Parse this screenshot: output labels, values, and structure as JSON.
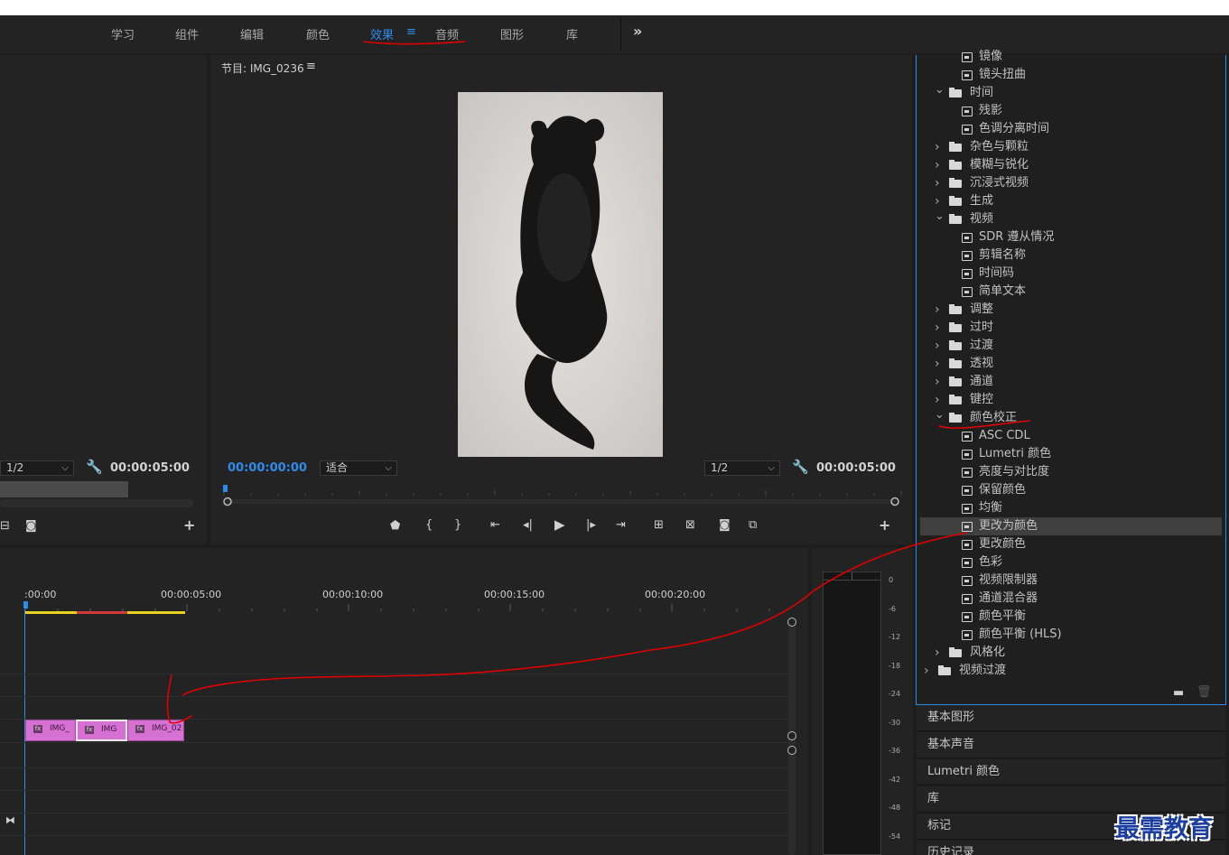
{
  "workspaces": [
    "学习",
    "组件",
    "编辑",
    "颜色",
    "效果",
    "音频",
    "图形",
    "库"
  ],
  "active_workspace": "效果",
  "menu_glyph": "≡",
  "overflow_glyph": "»",
  "source_monitor": {
    "zoom": "1/2",
    "duration": "00:00:05:00"
  },
  "program_monitor": {
    "title": "节目: IMG_0236",
    "timecode": "00:00:00:00",
    "fit": "适合",
    "zoom": "1/2",
    "duration": "00:00:05:00"
  },
  "effects_tree": [
    {
      "label": "镜像",
      "type": "effect"
    },
    {
      "label": "镜头扭曲",
      "type": "effect"
    },
    {
      "label": "时间",
      "type": "folder",
      "open": true
    },
    {
      "label": "残影",
      "type": "effect"
    },
    {
      "label": "色调分离时间",
      "type": "effect"
    },
    {
      "label": "杂色与颗粒",
      "type": "folder",
      "open": false
    },
    {
      "label": "模糊与锐化",
      "type": "folder",
      "open": false
    },
    {
      "label": "沉浸式视频",
      "type": "folder",
      "open": false
    },
    {
      "label": "生成",
      "type": "folder",
      "open": false
    },
    {
      "label": "视频",
      "type": "folder",
      "open": true
    },
    {
      "label": "SDR 遵从情况",
      "type": "effect"
    },
    {
      "label": "剪辑名称",
      "type": "effect"
    },
    {
      "label": "时间码",
      "type": "effect"
    },
    {
      "label": "简单文本",
      "type": "effect"
    },
    {
      "label": "调整",
      "type": "folder",
      "open": false
    },
    {
      "label": "过时",
      "type": "folder",
      "open": false
    },
    {
      "label": "过渡",
      "type": "folder",
      "open": false
    },
    {
      "label": "透视",
      "type": "folder",
      "open": false
    },
    {
      "label": "通道",
      "type": "folder",
      "open": false
    },
    {
      "label": "键控",
      "type": "folder",
      "open": false
    },
    {
      "label": "颜色校正",
      "type": "folder",
      "open": true
    },
    {
      "label": "ASC CDL",
      "type": "effect"
    },
    {
      "label": "Lumetri 颜色",
      "type": "effect"
    },
    {
      "label": "亮度与对比度",
      "type": "effect"
    },
    {
      "label": "保留颜色",
      "type": "effect"
    },
    {
      "label": "均衡",
      "type": "effect"
    },
    {
      "label": "更改为颜色",
      "type": "effect",
      "selected": true
    },
    {
      "label": "更改颜色",
      "type": "effect"
    },
    {
      "label": "色彩",
      "type": "effect"
    },
    {
      "label": "视频限制器",
      "type": "effect"
    },
    {
      "label": "通道混合器",
      "type": "effect"
    },
    {
      "label": "颜色平衡",
      "type": "effect"
    },
    {
      "label": "颜色平衡 (HLS)",
      "type": "effect"
    },
    {
      "label": "风格化",
      "type": "folder",
      "open": false
    },
    {
      "label": "视频过渡",
      "type": "folder",
      "open": false,
      "top": true
    }
  ],
  "side_panels": [
    "基本图形",
    "基本声音",
    "Lumetri 颜色",
    "库",
    "标记",
    "历史记录"
  ],
  "timeline": {
    "ruler": [
      ":00:00",
      "00:00:05:00",
      "00:00:10:00",
      "00:00:15:00",
      "00:00:20:00"
    ],
    "clips": [
      "IMG_",
      "IMG",
      "IMG_02"
    ],
    "fx_badge": "fx"
  },
  "audio_meter": {
    "scale": [
      "0",
      "-6",
      "-12",
      "-18",
      "-24",
      "-30",
      "-36",
      "-42",
      "-48",
      "-54"
    ]
  },
  "watermark": "最需教育",
  "colors": {
    "accent": "#2d8ceb",
    "clip": "#d670d3",
    "annotation": "#e00000"
  }
}
